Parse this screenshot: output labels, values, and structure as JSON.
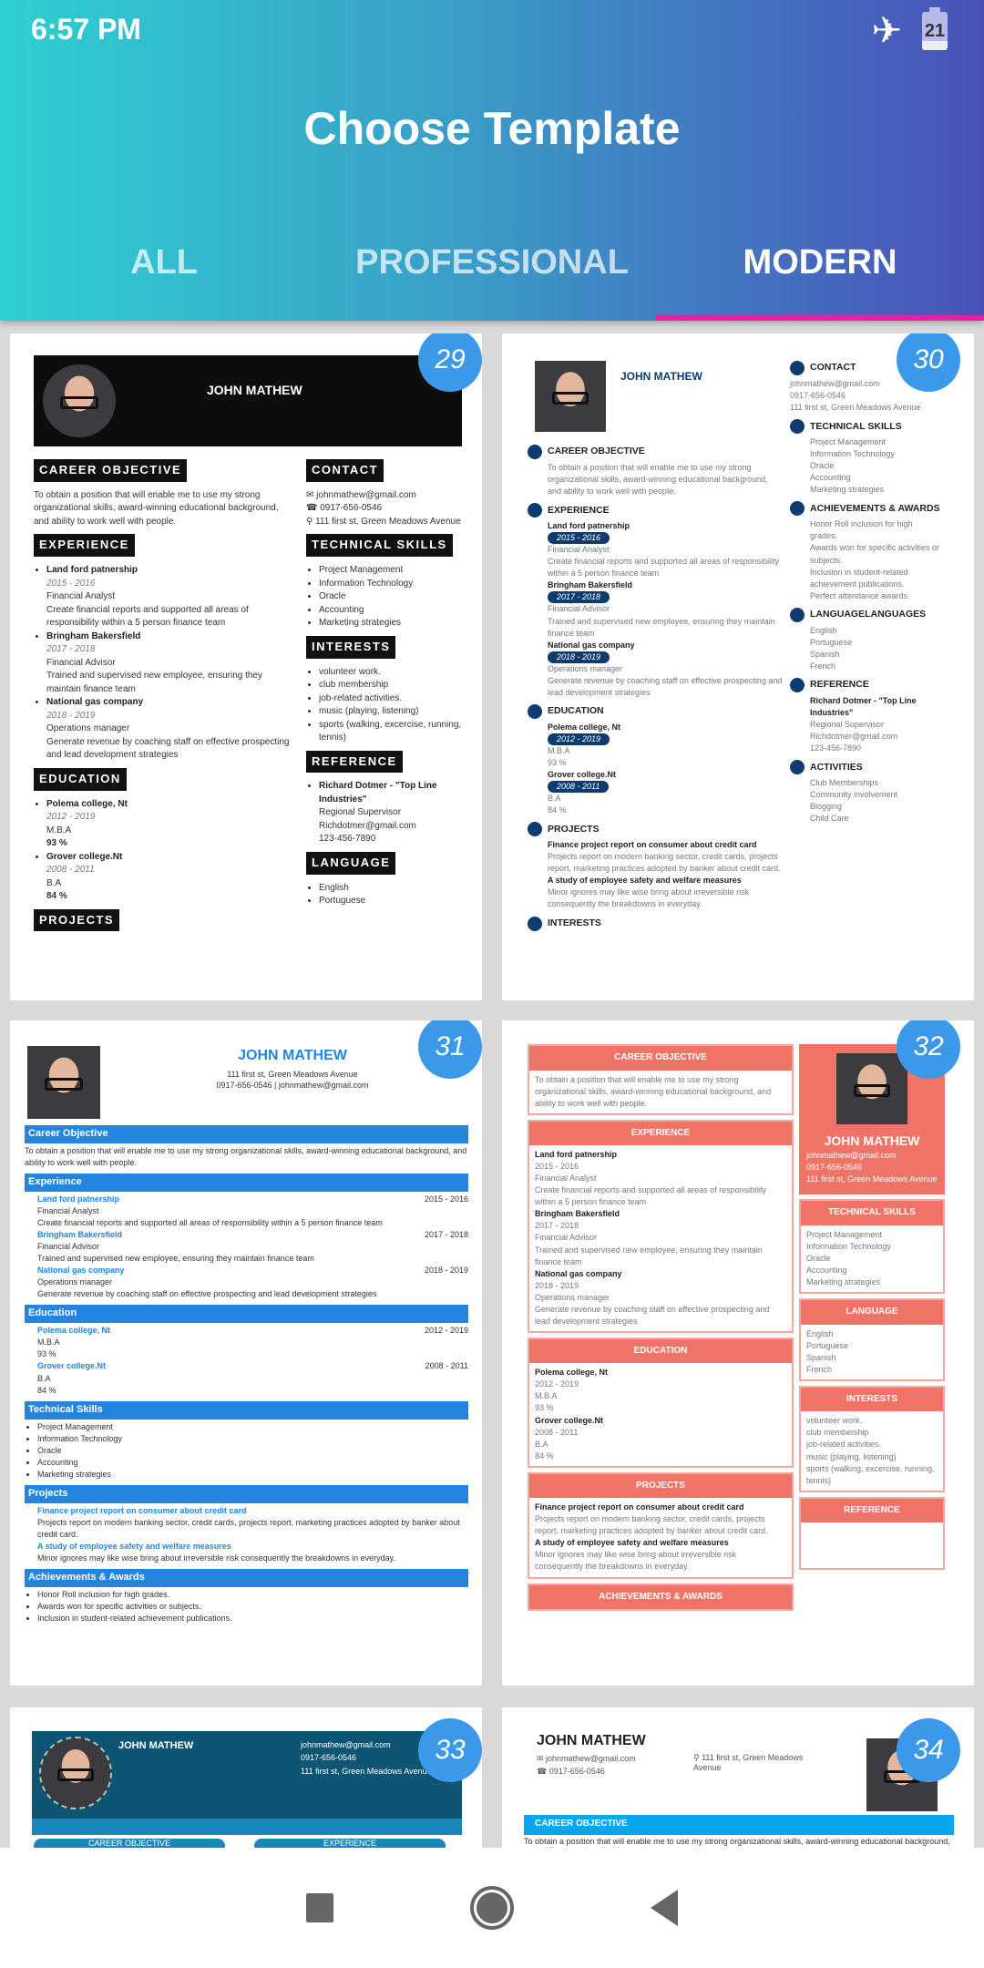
{
  "status_bar": {
    "time": "6:57 PM",
    "battery_level": "21",
    "airplane_mode_icon": "airplane-icon"
  },
  "header": {
    "title": "Choose Template"
  },
  "tabs": [
    {
      "label": "ALL",
      "active": false
    },
    {
      "label": "PROFESSIONAL",
      "active": false
    },
    {
      "label": "MODERN",
      "active": true
    }
  ],
  "accent_colors": {
    "tab_indicator": "#e91ea0",
    "badge": "#3c98e8"
  },
  "resume": {
    "name": "JOHN MATHEW",
    "email": "johnmathew@gmail.com",
    "phone": "0917-656-0546",
    "address": "111 first st, Green Meadows Avenue",
    "objective": "To obtain a position that will enable me to use my strong organizational skills, award-winning educational background, and ability to work well with people.",
    "experience": [
      {
        "company": "Land ford patnership",
        "years": "2015 - 2016",
        "role": "Financial Analyst",
        "desc": "Create financial reports and supported all areas of responsibility within a 5 person finance team"
      },
      {
        "company": "Bringham Bakersfield",
        "years": "2017 - 2018",
        "role": "Financial Advisor",
        "desc": "Trained and supervised new employee, ensuring they maintain finance team"
      },
      {
        "company": "National gas company",
        "years": "2018 - 2019",
        "role": "Operations manager",
        "desc": "Generate revenue by coaching staff on effective prospecting and lead development strategies"
      }
    ],
    "education": [
      {
        "school": "Polema college, Nt",
        "years": "2012 - 2019",
        "degree": "M.B.A",
        "score": "93 %"
      },
      {
        "school": "Grover college.Nt",
        "years": "2008 - 2011",
        "degree": "B.A",
        "score": "84 %"
      }
    ],
    "skills": [
      "Project Management",
      "Information Technology",
      "Oracle",
      "Accounting",
      "Marketing strategies"
    ],
    "interests": [
      "volunteer work.",
      "club membership",
      "job-related activities.",
      "music (playing, listening)",
      "sports (walking, excercise, running, tennis)"
    ],
    "reference": {
      "name": "Richard Dotmer - \"Top Line Industries\"",
      "title": "Regional Supervisor",
      "email": "Richdotmer@gmail.com",
      "phone": "123-456-7890"
    },
    "languages": [
      "English",
      "Portuguese",
      "Spanish",
      "French"
    ],
    "awards": [
      "Honor Roll inclusion for high grades.",
      "Awards won for specific activities or subjects.",
      "Inclusion in student-related achievement publications.",
      "Perfect attendance awards"
    ],
    "projects": [
      {
        "title": "Finance project report on consumer about credit card",
        "desc": "Projects report on modern banking sector, credit cards, projects report, marketing practices adopted by banker about credit card."
      },
      {
        "title": "A study of employee safety and welfare measures",
        "desc": "Minor ignores may like wise bring about irreversible risk consequently the breakdowns in everyday."
      }
    ],
    "activities": [
      "Club Memberships",
      "Community involvement",
      "Blogging",
      "Child Care"
    ]
  },
  "labels": {
    "career_objective": "CAREER OBJECTIVE",
    "experience": "EXPERIENCE",
    "education": "EDUCATION",
    "projects": "PROJECTS",
    "contact": "CONTACT",
    "technical_skills": "TECHNICAL SKILLS",
    "interests": "INTERESTS",
    "reference": "REFERENCE",
    "language": "LANGUAGE",
    "languages_t30": "LANGUAGELANGUAGES",
    "achievements": "ACHIEVEMENTS & AWARDS",
    "activities": "ACTIVITIES",
    "career_objective_tc": "Career Objective",
    "experience_tc": "Experience",
    "education_tc": "Education",
    "technical_skills_tc": "Technical Skills",
    "projects_tc": "Projects",
    "achievements_tc": "Achievements & Awards"
  },
  "templates": [
    {
      "number": "29"
    },
    {
      "number": "30"
    },
    {
      "number": "31"
    },
    {
      "number": "32"
    },
    {
      "number": "33"
    },
    {
      "number": "34"
    }
  ],
  "t31_contact_line": "0917-656-0546 | johnmathew@gmail.com"
}
